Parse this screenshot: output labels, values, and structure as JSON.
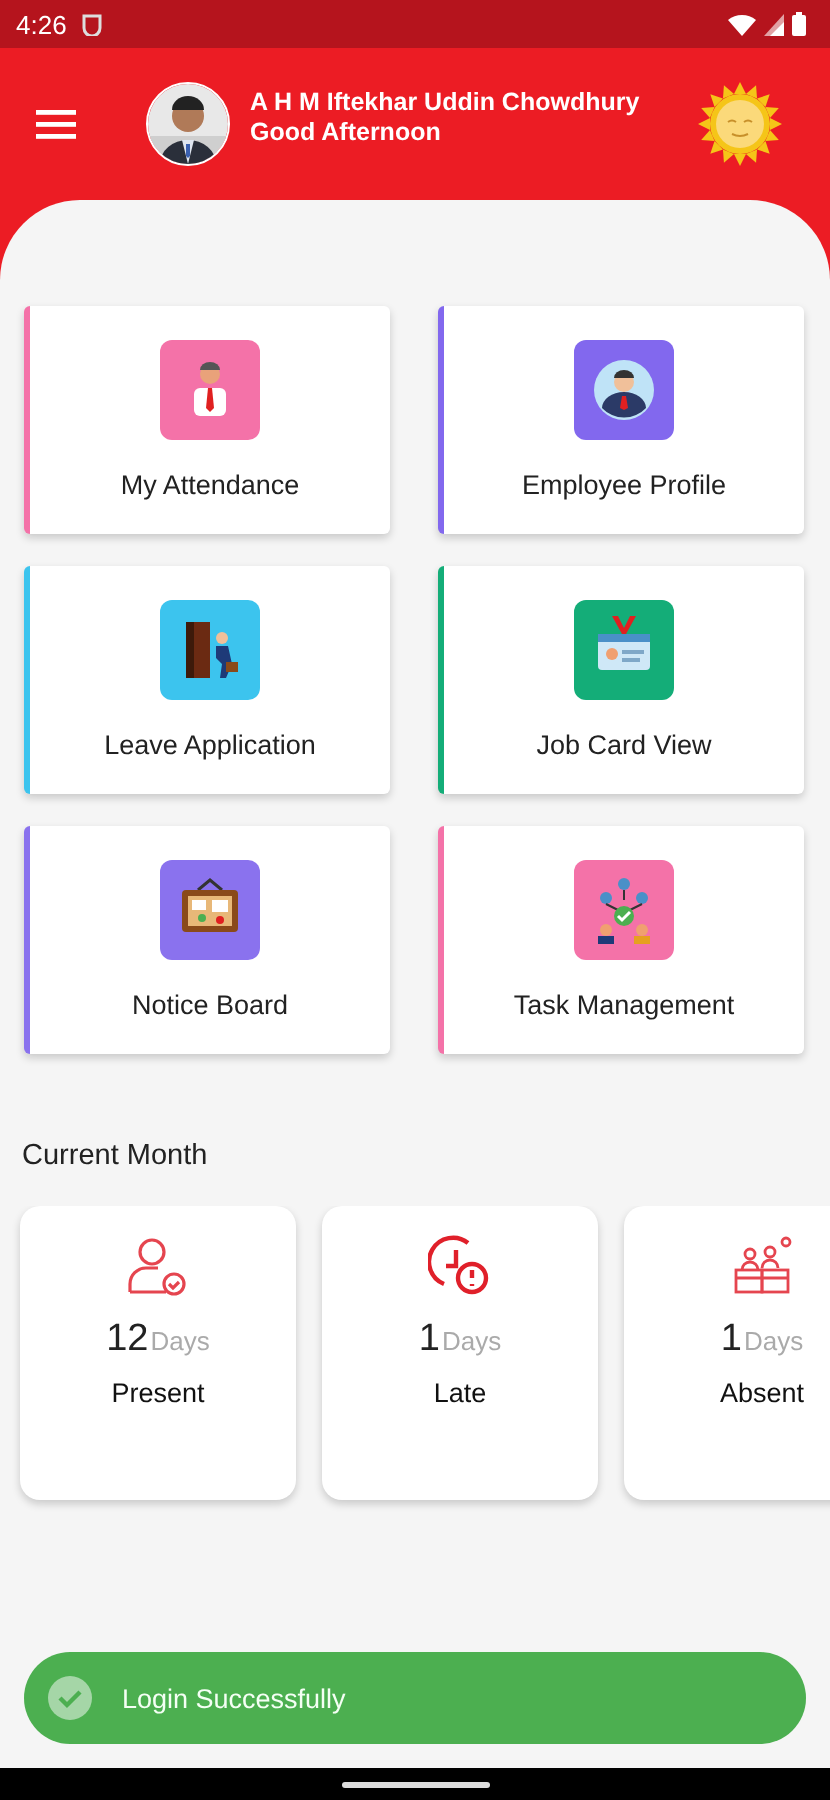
{
  "status_bar": {
    "time": "4:26"
  },
  "header": {
    "name": "A H M Iftekhar Uddin Chowdhury",
    "greeting": "Good Afternoon"
  },
  "menu_tiles": [
    {
      "kind": "attendance",
      "label": "My Attendance",
      "color": "#f472a8"
    },
    {
      "kind": "profile",
      "label": "Employee Profile",
      "color": "#8268ee"
    },
    {
      "kind": "leave",
      "label": "Leave Application",
      "color": "#3cc4ee"
    },
    {
      "kind": "job_card",
      "label": "Job Card View",
      "color": "#14ad78"
    },
    {
      "kind": "notice",
      "label": "Notice Board",
      "color": "#8a72ee"
    },
    {
      "kind": "task",
      "label": "Task Management",
      "color": "#f472a8"
    }
  ],
  "current_month": {
    "title": "Current Month",
    "stats": [
      {
        "kind": "present",
        "value": "12",
        "unit": "Days",
        "label": "Present"
      },
      {
        "kind": "late",
        "value": "1",
        "unit": "Days",
        "label": "Late"
      },
      {
        "kind": "absent",
        "value": "1",
        "unit": "Days",
        "label": "Absent"
      }
    ]
  },
  "toast": {
    "message": "Login Successfully"
  }
}
